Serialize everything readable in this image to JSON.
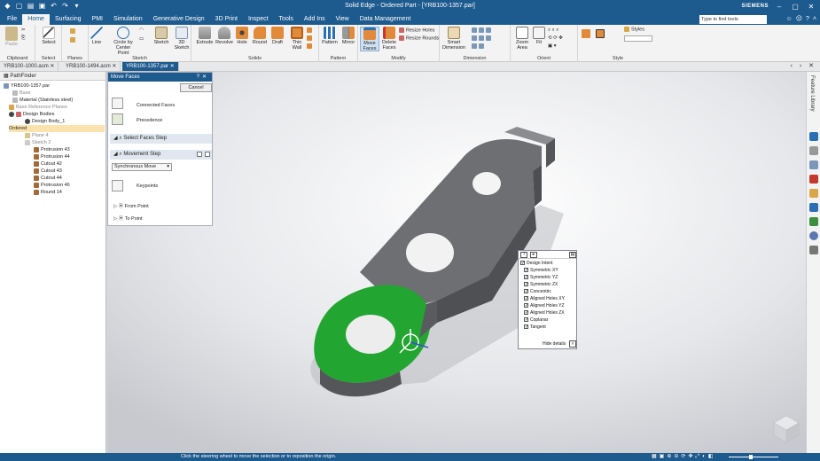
{
  "titlebar": {
    "title": "Solid Edge - Ordered Part - [YRB100-1357.par]",
    "brand": "SIEMENS"
  },
  "menu": {
    "tabs": [
      "File",
      "Home",
      "Surfacing",
      "PMI",
      "Simulation",
      "Generative Design",
      "3D Print",
      "Inspect",
      "Tools",
      "Add Ins",
      "View",
      "Data Management"
    ],
    "active_tab": "Home",
    "find_placeholder": "Type to find tools"
  },
  "ribbon": {
    "groups": {
      "clipboard": "Clipboard",
      "select": "Select",
      "planes": "Planes",
      "sketch": "Sketch",
      "solids": "Solids",
      "pattern": "Pattern",
      "modify": "Modify",
      "dimension": "Dimension",
      "orient": "Orient",
      "style": "Style"
    },
    "buttons": {
      "paste": "Paste",
      "select": "Select",
      "line": "Line",
      "circle": "Circle by Center Point",
      "sketch": "Sketch",
      "sketch3d": "3D Sketch",
      "extrude": "Extrude",
      "revolve": "Revolve",
      "hole": "Hole",
      "round": "Round",
      "draft": "Draft",
      "thinwall": "Thin Wall",
      "pattern": "Pattern",
      "mirror": "Mirror",
      "movefaces": "Move Faces",
      "deletefaces": "Delete Faces",
      "resizeholes": "Resize Holes",
      "resizerounds": "Resize Rounds",
      "smartdim": "Smart Dimension",
      "zoomarea": "Zoom Area",
      "fit": "Fit",
      "styles": "Styles"
    }
  },
  "doctabs": [
    "YRB100-1000.asm",
    "YRB100-1494.asm",
    "YRB100-1357.par"
  ],
  "pathfinder": {
    "header": "PathFinder",
    "items": [
      "YRB100-1357.par",
      "Base",
      "Material (Stainless steel)",
      "Base Reference Planes",
      "Design Bodies",
      "Design Body_1",
      "Ordered",
      "Plane 4",
      "Sketch 2",
      "Protrusion 43",
      "Protrusion 44",
      "Cutout 42",
      "Cutout 43",
      "Cutout 44",
      "Protrusion 46",
      "Round 14"
    ]
  },
  "movefaces": {
    "title": "Move Faces",
    "cancel": "Cancel",
    "connected_faces": "Connected Faces",
    "precedence": "Precedence",
    "select_faces_step": "Select Faces Step",
    "movement_step": "Movement Step",
    "move_type": "Synchronous Move",
    "keypoints": "Keypoints",
    "from_point": "From Point",
    "to_point": "To Point"
  },
  "design_intent": {
    "header": "Design Intent",
    "options": [
      "Symmetric XY",
      "Symmetric YZ",
      "Symmetric ZX",
      "Concentric",
      "Aligned Holes XY",
      "Aligned Holes YZ",
      "Aligned Holes ZX",
      "Coplanar",
      "Tangent"
    ],
    "hide_details": "Hide details"
  },
  "rightbar": {
    "label": "Feature Library"
  },
  "status": {
    "message": "Click the steering wheel to move the selection or to reposition the origin."
  },
  "colors": {
    "title_blue": "#1d5a8e",
    "selected_face_green": "#22a531",
    "part_grey": "#6c6d71"
  }
}
